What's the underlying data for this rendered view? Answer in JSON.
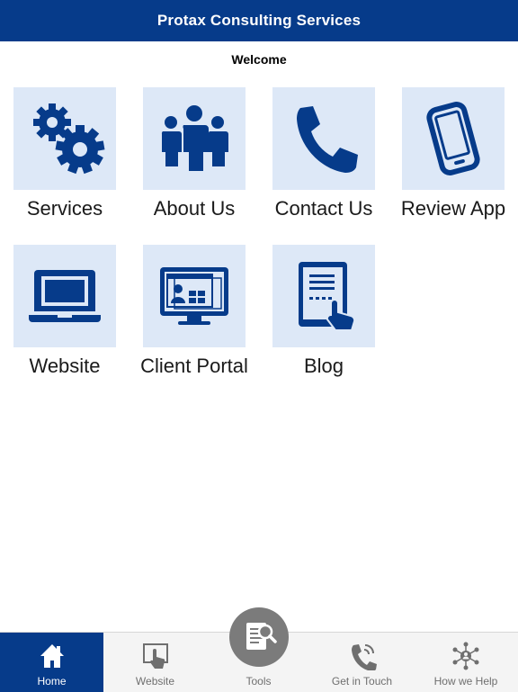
{
  "header": {
    "title": "Protax Consulting Services"
  },
  "welcome": "Welcome",
  "tiles": [
    {
      "label": "Services"
    },
    {
      "label": "About Us"
    },
    {
      "label": "Contact Us"
    },
    {
      "label": "Review App"
    },
    {
      "label": "Website"
    },
    {
      "label": "Client Portal"
    },
    {
      "label": "Blog"
    }
  ],
  "tabbar": {
    "items": [
      {
        "label": "Home",
        "icon": "home-icon",
        "active": true
      },
      {
        "label": "Website",
        "icon": "touch-screen-icon",
        "active": false
      },
      {
        "label": "Tools",
        "icon": "document-search-icon",
        "active": false
      },
      {
        "label": "Get in Touch",
        "icon": "phone-icon",
        "active": false
      },
      {
        "label": "How we Help",
        "icon": "network-icon",
        "active": false
      }
    ]
  },
  "colors": {
    "brand": "#063b8a",
    "tile_bg": "#dde8f7",
    "tab_bg": "#f4f4f4",
    "tools_circle": "#7b7b7b"
  }
}
